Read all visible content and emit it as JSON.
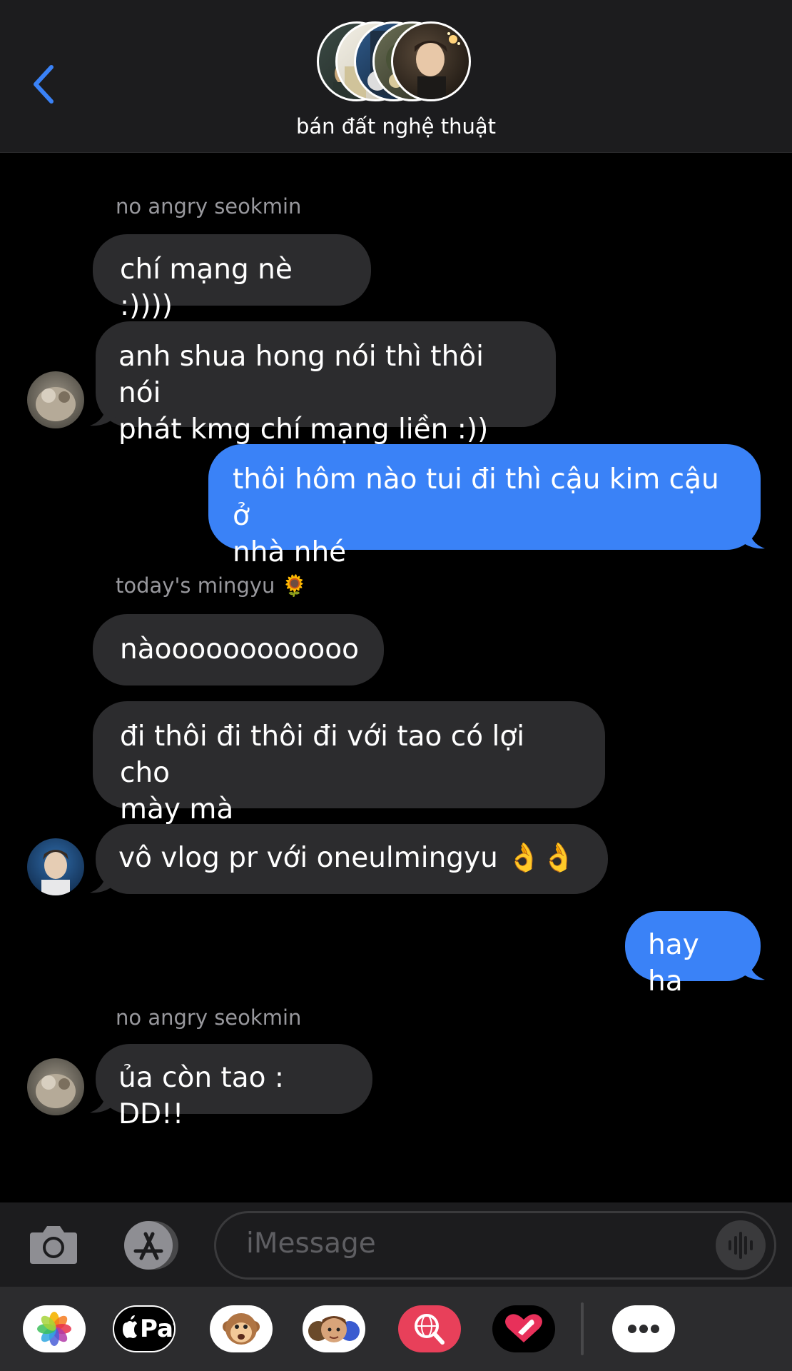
{
  "header": {
    "group_name": "bán đất nghệ thuật",
    "back_icon": "chevron-left-icon"
  },
  "messages": [
    {
      "type": "sender",
      "text": "no angry seokmin"
    },
    {
      "type": "in",
      "text": "chí mạng nè :))))"
    },
    {
      "type": "in",
      "lines": [
        "anh shua hong nói thì thôi nói",
        "phát kmg chí mạng liền :))"
      ]
    },
    {
      "type": "out",
      "lines": [
        "thôi hôm nào tui đi thì cậu kim cậu ở",
        "nhà nhé"
      ]
    },
    {
      "type": "sender",
      "text": "today's mingyu 🌻"
    },
    {
      "type": "in",
      "text": "nàoooooooooooo"
    },
    {
      "type": "in",
      "lines": [
        "đi thôi đi thôi đi với tao có lợi cho",
        "mày mà"
      ]
    },
    {
      "type": "in",
      "text": "vô vlog pr với oneulmingyu 👌👌"
    },
    {
      "type": "out",
      "text": "hay ha"
    },
    {
      "type": "sender",
      "text": "no angry seokmin"
    },
    {
      "type": "in",
      "text": "ủa còn tao : DD!!"
    }
  ],
  "input": {
    "placeholder": "iMessage"
  },
  "apps": [
    {
      "name": "photos-icon"
    },
    {
      "name": "apple-pay-icon",
      "label": "Pay"
    },
    {
      "name": "animoji-monkey-icon"
    },
    {
      "name": "memoji-icon"
    },
    {
      "name": "web-search-icon"
    },
    {
      "name": "digital-touch-icon"
    },
    {
      "name": "more-apps-icon"
    }
  ],
  "colors": {
    "outgoing_bubble": "#3a82f7",
    "incoming_bubble": "#2c2c2e",
    "accent": "#3a82f7"
  }
}
